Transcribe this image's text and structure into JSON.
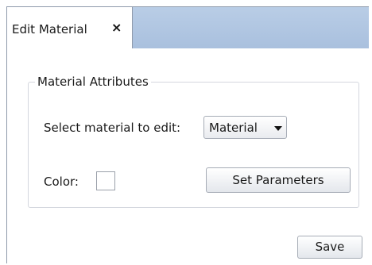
{
  "tab": {
    "label": "Edit Material",
    "close_glyph": "×",
    "close_icon": "close-icon"
  },
  "group": {
    "legend": "Material Attributes"
  },
  "material_select": {
    "label": "Select material to edit:",
    "selected": "Material",
    "caret_icon": "caret-down-icon"
  },
  "color": {
    "label": "Color:",
    "swatch_value": "#ffffff"
  },
  "buttons": {
    "set_parameters": "Set Parameters",
    "save": "Save"
  },
  "colors": {
    "tabbar": "#b2c7e2",
    "border": "#8f9aab"
  }
}
